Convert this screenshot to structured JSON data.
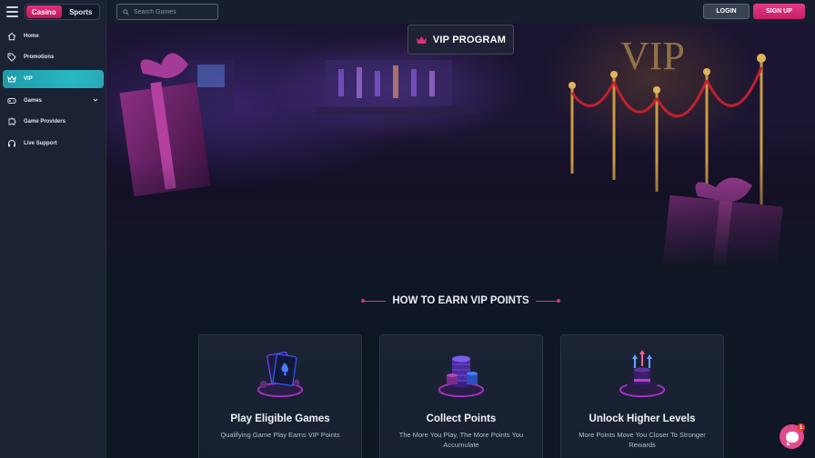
{
  "sidebar": {
    "mode_tabs": [
      {
        "label": "Casino",
        "active": true
      },
      {
        "label": "Sports",
        "active": false
      }
    ],
    "items": [
      {
        "label": "Home",
        "icon": "home-icon"
      },
      {
        "label": "Promotions",
        "icon": "tag-icon"
      },
      {
        "label": "VIP",
        "icon": "crown-icon",
        "active": true
      },
      {
        "label": "Games",
        "icon": "gamepad-icon",
        "expandable": true
      },
      {
        "label": "Game Providers",
        "icon": "puzzle-icon"
      },
      {
        "label": "Live Support",
        "icon": "headset-icon"
      }
    ]
  },
  "topbar": {
    "search_placeholder": "Search Games",
    "login_label": "LOGIN",
    "signup_label": "SIGN UP"
  },
  "hero": {
    "badge_label": "VIP PROGRAM",
    "sign_text": "VIP"
  },
  "earn": {
    "title": "HOW TO EARN VIP POINTS",
    "cards": [
      {
        "title": "Play Eligible Games",
        "text": "Qualifying Game Play Earns VIP Points",
        "icon": "playing-cards-icon"
      },
      {
        "title": "Collect Points",
        "text": "The More You Play, The More Points You Accumulate",
        "icon": "chip-stack-icon"
      },
      {
        "title": "Unlock Higher Levels",
        "text": "More Points Move You Closer To Stronger Rewards",
        "icon": "top-hat-arrows-icon"
      }
    ]
  },
  "chat": {
    "badge_count": "1"
  },
  "colors": {
    "accent_pink": "#e0307a",
    "active_teal": "#27b8c5",
    "background": "#0f1624"
  }
}
